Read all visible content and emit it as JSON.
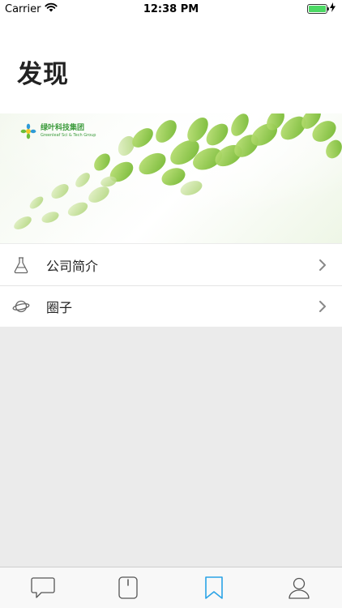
{
  "status_bar": {
    "carrier": "Carrier",
    "time": "12:38 PM",
    "battery_level": 1.0
  },
  "header": {
    "title": "发现"
  },
  "banner": {
    "logo_text": "绿叶科技集团",
    "logo_subtext": "Greenleaf Sci & Tech Group"
  },
  "menu": {
    "items": [
      {
        "label": "公司简介",
        "icon": "flask-icon"
      },
      {
        "label": "圈子",
        "icon": "planet-icon"
      }
    ]
  },
  "tab_bar": {
    "tabs": [
      {
        "icon": "chat-bubble-icon",
        "active": false
      },
      {
        "icon": "phone-device-icon",
        "active": false
      },
      {
        "icon": "bookmark-icon",
        "active": true
      },
      {
        "icon": "user-icon",
        "active": false
      }
    ],
    "active_color": "#2aa3e6",
    "inactive_color": "#555555"
  },
  "colors": {
    "background": "#ebebeb",
    "logo_green": "#3a9a3a",
    "leaf_green": "#8cc63f"
  }
}
